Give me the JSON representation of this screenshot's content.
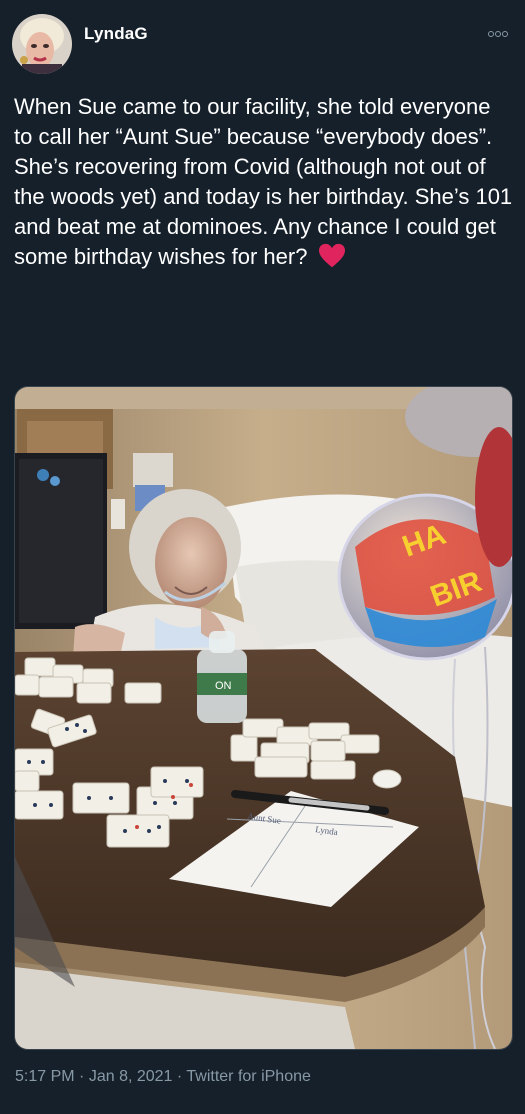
{
  "tweet": {
    "username": "LyndaG",
    "text": "When Sue came to our facility, she told everyone to call her “Aunt Sue” because “everybody does”.  She’s recovering from Covid (although not out of the woods yet) and today is her birthday. She’s 101 and beat me at dominoes. Any chance I could get some birthday wishes for her?",
    "heart_emoji": "❤️",
    "time": "5:17 PM",
    "separator": "·",
    "date": "Jan 8, 2021",
    "source": "Twitter for iPhone"
  },
  "photo": {
    "balloon_text_1": "HA",
    "balloon_text_2": "BIR",
    "bottle_label": "ON",
    "paper_text_1": "Aunt Sue",
    "paper_text_2": "Lynda"
  },
  "icons": {
    "more": "more-options-icon",
    "heart": "heart-icon"
  },
  "colors": {
    "background": "#15202b",
    "text": "#ffffff",
    "muted": "#8899a6",
    "heart": "#e0245e"
  }
}
